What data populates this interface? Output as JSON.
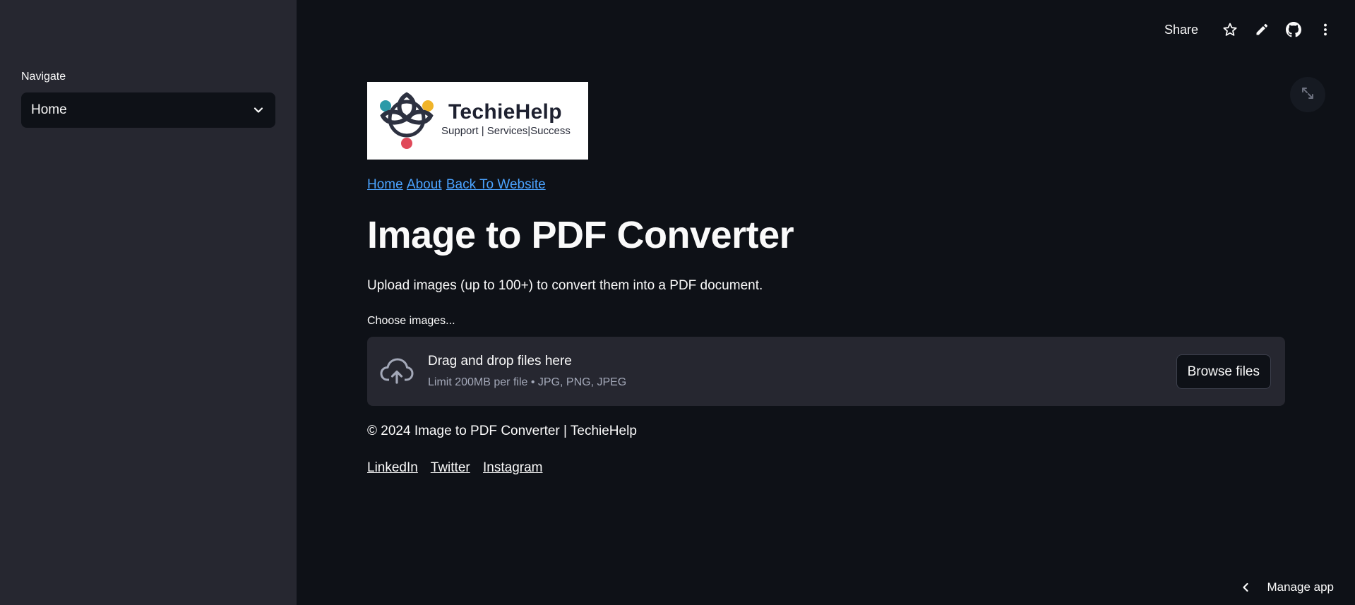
{
  "sidebar": {
    "nav_label": "Navigate",
    "nav_selected": "Home"
  },
  "toolbar": {
    "share_label": "Share",
    "icons": [
      "star-icon",
      "pencil-icon",
      "github-icon",
      "more-vertical-icon"
    ]
  },
  "logo": {
    "title": "TechieHelp",
    "subtitle": "Support | Services|Success"
  },
  "top_links": {
    "home": "Home",
    "about": "About",
    "back": "Back To Website"
  },
  "main": {
    "title": "Image to PDF Converter",
    "subtitle": "Upload images (up to 100+) to convert them into a PDF document."
  },
  "uploader": {
    "label": "Choose images...",
    "drop_text": "Drag and drop files here",
    "limit_text": "Limit 200MB per file • JPG, PNG, JPEG",
    "browse_label": "Browse files"
  },
  "footer": {
    "copyright": "© 2024 Image to PDF Converter | TechieHelp",
    "linkedin": "LinkedIn",
    "twitter": "Twitter",
    "instagram": "Instagram"
  },
  "manage_app": {
    "label": "Manage app"
  },
  "colors": {
    "background": "#0e1117",
    "sidebar": "#262730",
    "link": "#4ba3ff",
    "logo_teal": "#2a9aa8",
    "logo_yellow": "#f0b429",
    "logo_red": "#e04a5a"
  }
}
